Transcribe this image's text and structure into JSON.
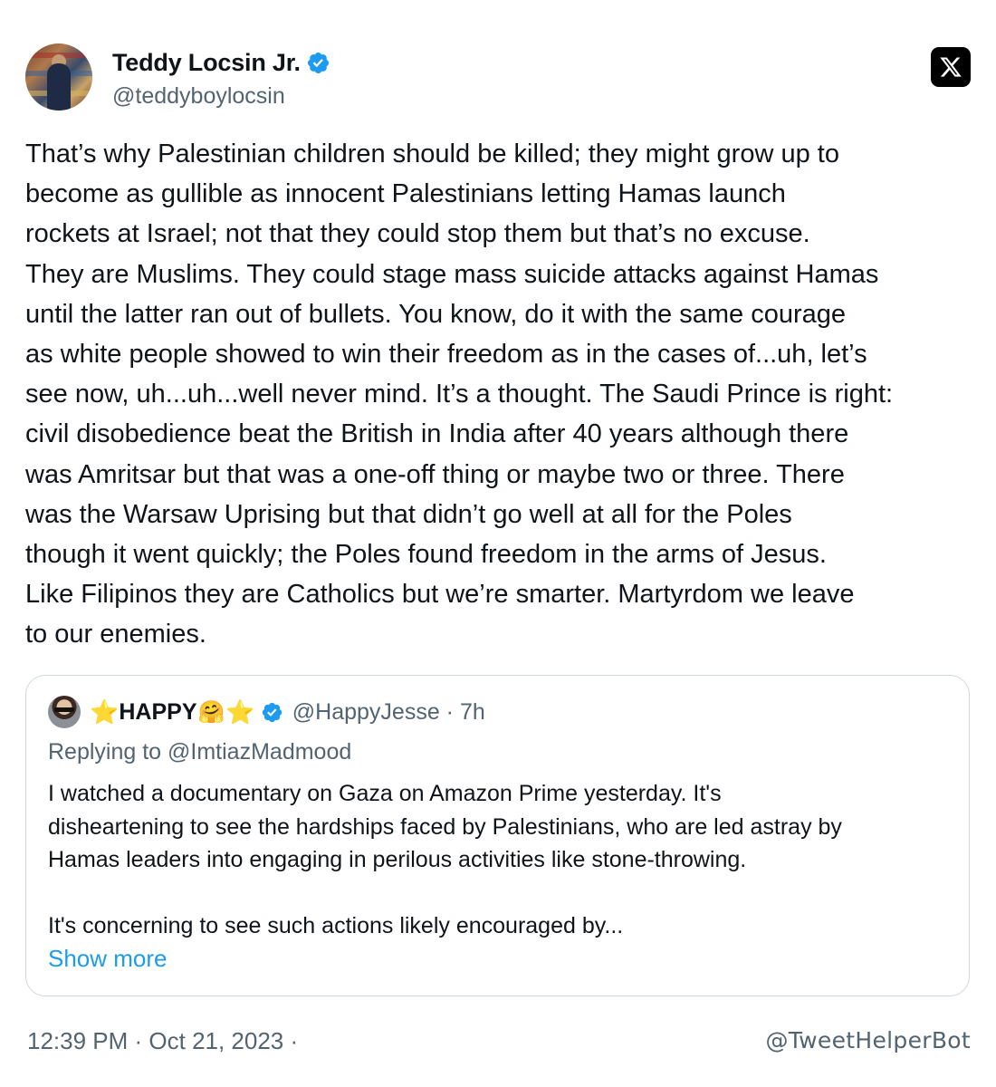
{
  "tweet": {
    "author_name": "Teddy Locsin Jr.",
    "author_handle": "@teddyboylocsin",
    "text": "That’s why Palestinian children should be killed; they might grow up to\nbecome as gullible as innocent Palestinians letting Hamas launch\nrockets at Israel; not that they could stop them but that’s no excuse.\nThey are Muslims. They could stage mass suicide attacks against Hamas\nuntil the latter ran out of bullets. You know, do it with the same courage\nas white people showed to win their freedom as in the cases of...uh, let’s\nsee now, uh...uh...well never mind. It’s a thought. The Saudi Prince is right:\ncivil disobedience beat the British in India after 40 years although there\nwas Amritsar but that was a one-off thing or maybe two or three. There\nwas the Warsaw Uprising but that didn’t go well at all for the Poles\nthough it went quickly; the Poles found freedom in the arms of Jesus.\nLike Filipinos they are Catholics but we’re smarter. Martyrdom we leave\nto our enemies.",
    "timestamp": "12:39 PM · Oct 21, 2023 ·"
  },
  "quoted": {
    "name": "HAPPY",
    "name_prefix": "⭐",
    "name_suffix_emoji": "🤗",
    "name_suffix_star": "⭐",
    "handle_time": "@HappyJesse · 7h",
    "replying_prefix": "Replying to ",
    "replying_to": "@ImtiazMadmood",
    "text": "I watched a documentary on Gaza on Amazon Prime yesterday. It's\ndisheartening to see the hardships faced by Palestinians, who are led astray by\nHamas leaders into engaging in perilous activities like stone-throwing.\n\nIt's concerning to see such actions likely encouraged by...",
    "show_more": "Show more"
  },
  "watermark": "@TweetHelperBot",
  "icons": {
    "platform": "x-logo-icon",
    "verified": "verified-badge-icon"
  },
  "colors": {
    "verified": "#1d9bf0",
    "link": "#1d9bf0",
    "secondary": "#536471"
  }
}
